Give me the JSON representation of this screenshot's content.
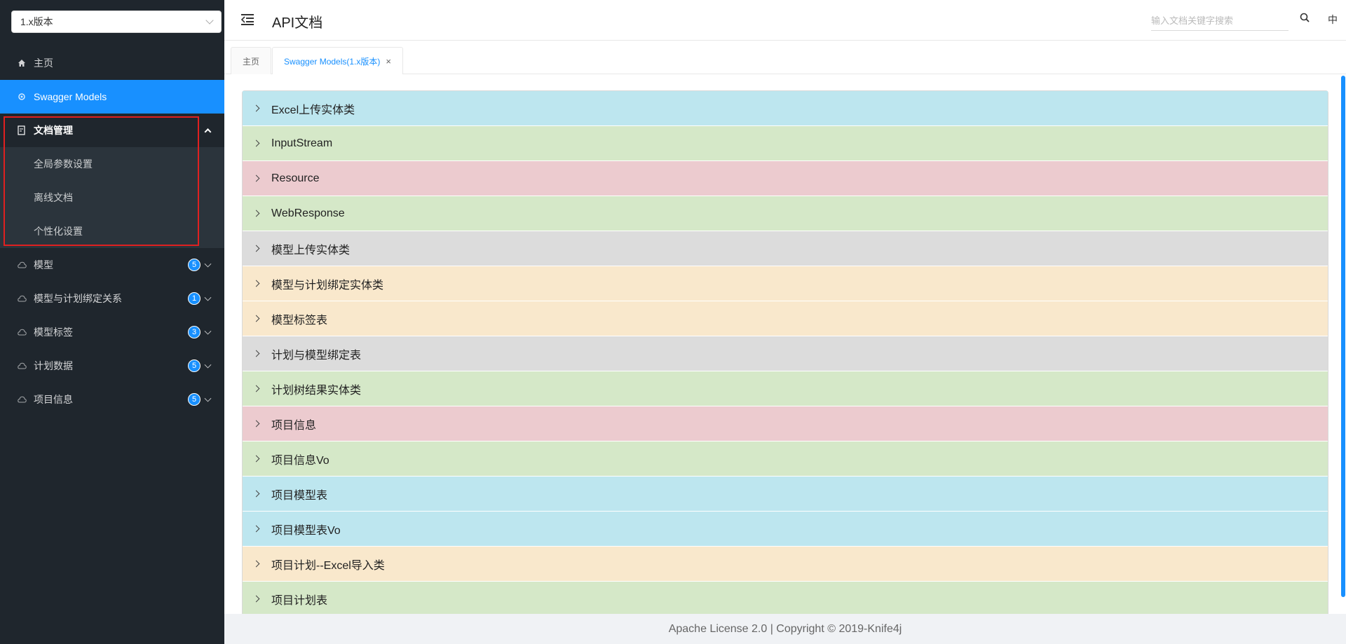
{
  "sidebar": {
    "version_value": "1.x版本",
    "menu": [
      {
        "label": "主页",
        "icon": "home-icon",
        "state": "normal"
      },
      {
        "label": "Swagger Models",
        "icon": "gear-icon",
        "state": "active"
      },
      {
        "label": "文档管理",
        "icon": "document-icon",
        "state": "open"
      }
    ],
    "submenu": [
      {
        "label": "全局参数设置"
      },
      {
        "label": "离线文档"
      },
      {
        "label": "个性化设置"
      }
    ],
    "groups": [
      {
        "label": "模型",
        "count": "5",
        "icon": "cloud-icon"
      },
      {
        "label": "模型与计划绑定关系",
        "count": "1",
        "icon": "cloud-icon"
      },
      {
        "label": "模型标签",
        "count": "3",
        "icon": "cloud-icon"
      },
      {
        "label": "计划数据",
        "count": "5",
        "icon": "cloud-icon"
      },
      {
        "label": "项目信息",
        "count": "5",
        "icon": "cloud-icon"
      }
    ]
  },
  "header": {
    "title": "API文档",
    "search_placeholder": "输入文档关键字搜索",
    "lang": "中"
  },
  "tabs": [
    {
      "label": "主页",
      "active": false
    },
    {
      "label": "Swagger Models(1.x版本)",
      "active": true,
      "close": "×"
    }
  ],
  "models": [
    {
      "label": "Excel上传实体类",
      "color": "#bde6ef"
    },
    {
      "label": "InputStream",
      "color": "#d5e8c8"
    },
    {
      "label": "Resource",
      "color": "#eccbcf"
    },
    {
      "label": "WebResponse",
      "color": "#d5e8c8"
    },
    {
      "label": "模型上传实体类",
      "color": "#dcdcdc"
    },
    {
      "label": "模型与计划绑定实体类",
      "color": "#f9e8cc"
    },
    {
      "label": "模型标签表",
      "color": "#f9e8cc"
    },
    {
      "label": "计划与模型绑定表",
      "color": "#dcdcdc"
    },
    {
      "label": "计划树结果实体类",
      "color": "#d5e8c8"
    },
    {
      "label": "项目信息",
      "color": "#eccbcf"
    },
    {
      "label": "项目信息Vo",
      "color": "#d5e8c8"
    },
    {
      "label": "项目模型表",
      "color": "#bde6ef"
    },
    {
      "label": "项目模型表Vo",
      "color": "#bde6ef"
    },
    {
      "label": "项目计划--Excel导入类",
      "color": "#f9e8cc"
    },
    {
      "label": "项目计划表",
      "color": "#d5e8c8"
    }
  ],
  "footer": {
    "text": "Apache License 2.0 | Copyright © 2019-Knife4j"
  }
}
